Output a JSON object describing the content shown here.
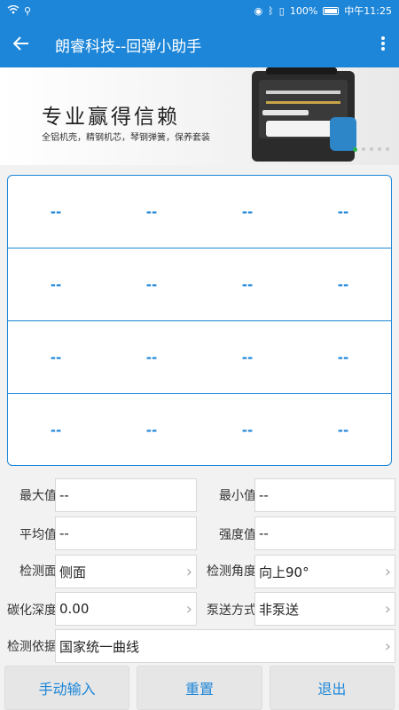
{
  "status_bar": {
    "battery": "100%",
    "time": "中午11:25"
  },
  "app_bar": {
    "title": "朗睿科技--回弹小助手",
    "back_icon": "arrow-left-icon",
    "menu_icon": "more-vertical-icon"
  },
  "banner": {
    "headline": "专业赢得信赖",
    "subline": "全铝机壳，精钢机芯，琴钢弹簧，保养套装",
    "slide_count": 5,
    "active_slide": 1
  },
  "grid": {
    "rows": [
      [
        "--",
        "--",
        "--",
        "--"
      ],
      [
        "--",
        "--",
        "--",
        "--"
      ],
      [
        "--",
        "--",
        "--",
        "--"
      ],
      [
        "--",
        "--",
        "--",
        "--"
      ]
    ]
  },
  "form": {
    "max": {
      "label": "最大值",
      "value": "--"
    },
    "min": {
      "label": "最小值",
      "value": "--"
    },
    "avg": {
      "label": "平均值",
      "value": "--"
    },
    "strength": {
      "label": "强度值",
      "value": "--"
    },
    "surface": {
      "label": "检测面",
      "value": "侧面"
    },
    "angle": {
      "label": "检测角度",
      "value": "向上90°"
    },
    "carbonation": {
      "label": "碳化深度",
      "value": "0.00"
    },
    "pump": {
      "label": "泵送方式",
      "value": "非泵送"
    },
    "basis": {
      "label": "检测依据",
      "value": "国家统一曲线"
    }
  },
  "actions": {
    "manual": "手动输入",
    "reset": "重置",
    "exit": "退出"
  },
  "colors": {
    "primary": "#1d86d8",
    "accent_dot": "#27b34a"
  }
}
